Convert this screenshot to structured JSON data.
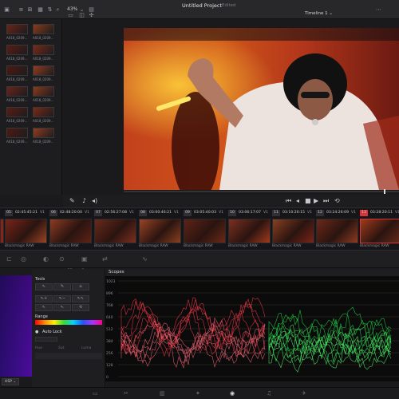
{
  "header": {
    "title": "Untitled Project",
    "status": "Edited",
    "zoom": "43%",
    "timeline": "Timeline 1 ⌄"
  },
  "media_pool": {
    "clips": [
      "A018_0209...",
      "A018_0209...",
      "A018_0209...",
      "A018_0209...",
      "A018_0209...",
      "A018_0209...",
      "A018_0209...",
      "A018_0209...",
      "A018_0209...",
      "A018_0209...",
      "A018_0209...",
      "A018_0209..."
    ]
  },
  "clips": [
    {
      "num": "05",
      "time": "02:45:45:21",
      "track": "V1",
      "codec": ""
    },
    {
      "num": "06",
      "time": "02:48:20:00",
      "track": "V1",
      "codec": "Blackmagic RAW"
    },
    {
      "num": "07",
      "time": "02:56:27:08",
      "track": "V1",
      "codec": "Blackmagic RAW"
    },
    {
      "num": "08",
      "time": "03:00:46:21",
      "track": "V1",
      "codec": "Blackmagic RAW"
    },
    {
      "num": "09",
      "time": "03:05:40:03",
      "track": "V1",
      "codec": "Blackmagic RAW"
    },
    {
      "num": "10",
      "time": "03:06:17:07",
      "track": "V1",
      "codec": "Blackmagic RAW"
    },
    {
      "num": "11",
      "time": "03:10:26:15",
      "track": "V1",
      "codec": "Blackmagic RAW"
    },
    {
      "num": "12",
      "time": "03:24:26:09",
      "track": "V1",
      "codec": "Blackmagic RAW"
    },
    {
      "num": "13",
      "time": "03:28:20:11",
      "track": "V1",
      "codec": "Blackmagic RAW"
    }
  ],
  "first_clip_codec": "Blackmagic RAW",
  "color_panel": {
    "tools_label": "Tools",
    "range_label": "Range",
    "auto_lock": "Auto Lock",
    "fields": [
      "Hue",
      "Sat",
      "Luma"
    ],
    "mode": "HSP ⌄"
  },
  "scopes": {
    "title": "Scopes",
    "scale": [
      "1023",
      "896",
      "768",
      "640",
      "512",
      "384",
      "256",
      "128",
      "0"
    ]
  },
  "accent_color": "#d8353a"
}
